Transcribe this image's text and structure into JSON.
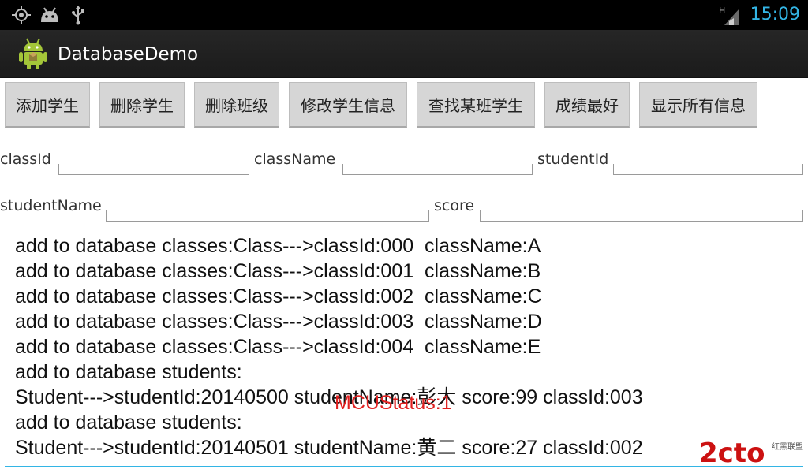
{
  "status_bar": {
    "time": "15:09",
    "icons": [
      "gps-icon",
      "android-debug-icon",
      "usb-icon",
      "signal-icon"
    ],
    "signal_label": "H"
  },
  "action_bar": {
    "title": "DatabaseDemo",
    "icon": "android-robot-icon"
  },
  "buttons": [
    {
      "label": "添加学生"
    },
    {
      "label": "删除学生"
    },
    {
      "label": "删除班级"
    },
    {
      "label": "修改学生信息"
    },
    {
      "label": "查找某班学生"
    },
    {
      "label": "成绩最好"
    },
    {
      "label": "显示所有信息"
    }
  ],
  "form": {
    "classId_label": "classId",
    "className_label": "className",
    "studentId_label": "studentId",
    "studentName_label": "studentName",
    "score_label": "score",
    "classId_value": "",
    "className_value": "",
    "studentId_value": "",
    "studentName_value": "",
    "score_value": ""
  },
  "output": {
    "lines": [
      "add to database classes:Class--->classId:000  className:A",
      "add to database classes:Class--->classId:001  className:B",
      "add to database classes:Class--->classId:002  className:C",
      "add to database classes:Class--->classId:003  className:D",
      "add to database classes:Class--->classId:004  className:E",
      "add to database students:",
      "Student--->studentId:20140500 studentName:彭大 score:99 classId:003",
      "add to database students:",
      "Student--->studentId:20140501 studentName:黄二 score:27 classId:002"
    ]
  },
  "overlay": {
    "status_text": "MCUStatus:1"
  },
  "watermark": {
    "brand": "2cto",
    "tag": "红黑联盟"
  },
  "colors": {
    "accent": "#33b5e5",
    "overlay_red": "#e02020",
    "watermark_red": "#cc1111"
  }
}
